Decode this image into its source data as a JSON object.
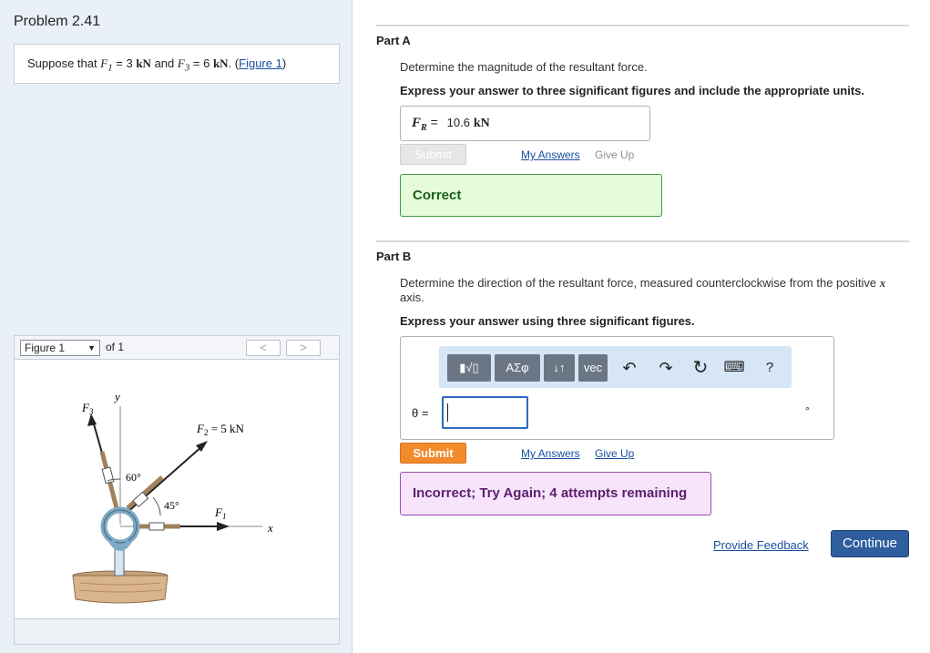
{
  "problem": {
    "title": "Problem 2.41",
    "statement_prefix": "Suppose that",
    "f1_label": "F",
    "f1_sub": "1",
    "f1_value": "= 3",
    "f1_unit": "kN",
    "and": "and",
    "f3_label": "F",
    "f3_sub": "3",
    "f3_value": "= 6",
    "f3_unit": "kN",
    "figure_link": "Figure 1"
  },
  "figure": {
    "selected": "Figure 1",
    "of_text": "of 1",
    "prev": "<",
    "next": ">",
    "labels": {
      "y": "y",
      "x": "x",
      "f3": "F",
      "f3_sub": "3",
      "f2": "F",
      "f2_sub": "2",
      "f2_value": " = 5 kN",
      "f1": "F",
      "f1_sub": "1",
      "angle60": "60°",
      "angle45": "45°"
    }
  },
  "partA": {
    "title": "Part A",
    "question": "Determine the magnitude of the resultant force.",
    "instruction": "Express your answer to three significant figures and include the appropriate units.",
    "answer_label_main": "F",
    "answer_label_sub": "R",
    "answer_eq": "=",
    "answer_value": "10.6",
    "answer_unit": "kN",
    "submit": "Submit",
    "my_answers": "My Answers",
    "give_up": "Give Up",
    "feedback": "Correct"
  },
  "partB": {
    "title": "Part B",
    "question_prefix": "Determine the direction of the resultant force, measured counterclockwise from the positive",
    "question_var": "x",
    "question_suffix": "axis.",
    "instruction": "Express your answer using three significant figures.",
    "toolbar": {
      "templates": "▮√▯",
      "greek": "ΑΣφ",
      "arrows": "↓↑",
      "vec": "vec",
      "undo": "↶",
      "redo": "↷",
      "reset": "↻",
      "keyboard": "⌨",
      "help": "?"
    },
    "input_label": "θ =",
    "input_value": "",
    "unit": "°",
    "submit": "Submit",
    "my_answers": "My Answers",
    "give_up": "Give Up",
    "feedback": "Incorrect; Try Again; 4 attempts remaining"
  },
  "footer": {
    "provide_feedback": "Provide Feedback",
    "continue": "Continue"
  },
  "colors": {
    "correct_bg": "#e5fbd9",
    "incorrect_bg": "#f7e4fb",
    "submit_orange": "#f28a2c",
    "continue_blue": "#2e5e9e"
  }
}
